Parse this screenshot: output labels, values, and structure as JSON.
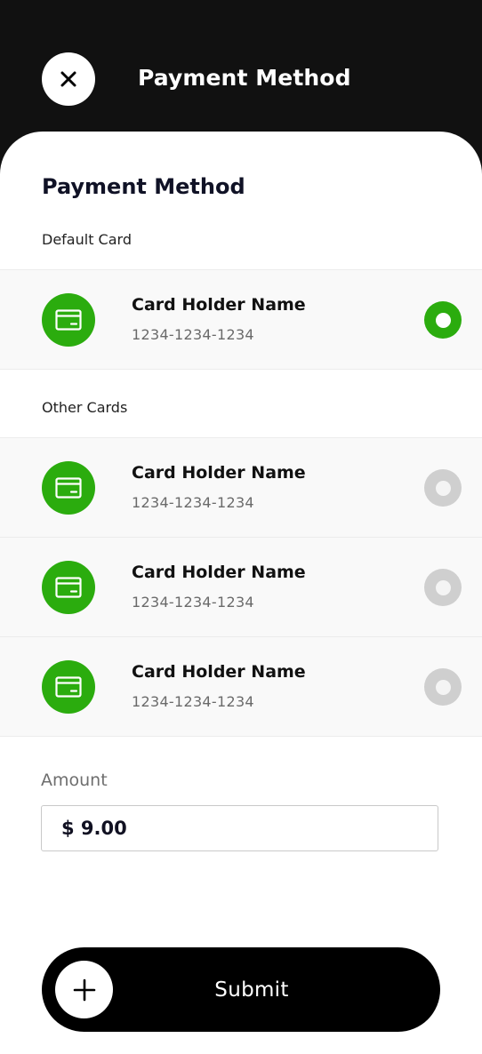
{
  "header": {
    "title": "Payment Method"
  },
  "section": {
    "title": "Payment Method",
    "default_label": "Default Card",
    "other_label": "Other Cards"
  },
  "default_card": {
    "name": "Card Holder Name",
    "number": "1234-1234-1234",
    "selected": true
  },
  "other_cards": [
    {
      "name": "Card Holder Name",
      "number": "1234-1234-1234",
      "selected": false
    },
    {
      "name": "Card Holder Name",
      "number": "1234-1234-1234",
      "selected": false
    },
    {
      "name": "Card Holder Name",
      "number": "1234-1234-1234",
      "selected": false
    }
  ],
  "amount": {
    "label": "Amount",
    "value": "$ 9.00"
  },
  "submit": {
    "label": "Submit",
    "icon": "plus-icon"
  },
  "icons": {
    "close": "close-icon",
    "card": "credit-card-icon"
  },
  "colors": {
    "accent": "#2bac0e",
    "header_bg": "#111111",
    "radio_off": "#cfcfcf"
  }
}
